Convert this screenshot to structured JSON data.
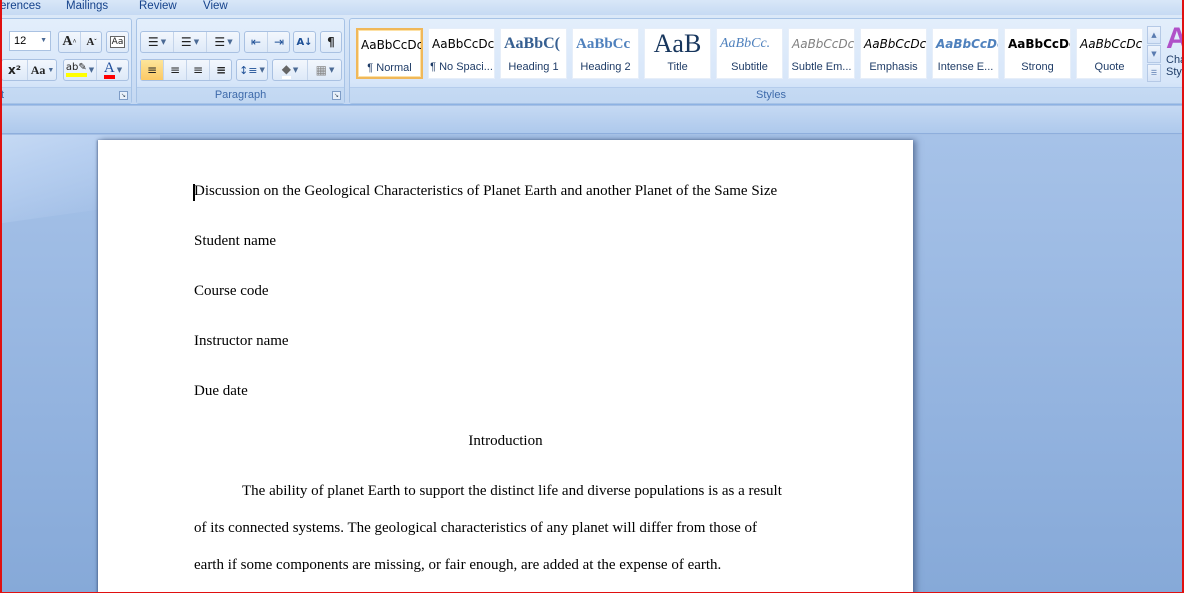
{
  "tabs": [
    "erences",
    "Mailings",
    "Review",
    "View"
  ],
  "font_group": {
    "label": "t",
    "font_size": "12",
    "buttons": {
      "grow_font": "A",
      "shrink_font": "A",
      "clear_formatting": "Aa",
      "superscript": "x²",
      "change_case": "Aa",
      "highlight": "ab",
      "font_color": "A"
    },
    "highlight_color": "#ffff00",
    "font_color": "#ff0000"
  },
  "paragraph_group": {
    "label": "Paragraph",
    "buttons": {
      "bullets": "☰",
      "numbering": "☰",
      "multilevel": "☰",
      "decrease_indent": "⇤",
      "increase_indent": "⇥",
      "sort": "A↓",
      "show_marks": "¶",
      "align_left": "≡",
      "center": "≡",
      "align_right": "≡",
      "justify": "≡",
      "line_spacing": "↕≡",
      "shading": "◆",
      "borders": "▦"
    },
    "active_alignment": "align_left"
  },
  "styles_group": {
    "label": "Styles",
    "items": [
      {
        "sample": "AaBbCcDc",
        "name": "¶ Normal",
        "selected": true
      },
      {
        "sample": "AaBbCcDc",
        "name": "¶ No Spaci..."
      },
      {
        "sample": "AaBbC(",
        "name": "Heading 1"
      },
      {
        "sample": "AaBbCc",
        "name": "Heading 2"
      },
      {
        "sample": "AaB",
        "name": "Title"
      },
      {
        "sample": "AaBbCc.",
        "name": "Subtitle"
      },
      {
        "sample": "AaBbCcDc",
        "name": "Subtle Em..."
      },
      {
        "sample": "AaBbCcDc",
        "name": "Emphasis"
      },
      {
        "sample": "AaBbCcDc",
        "name": "Intense E..."
      },
      {
        "sample": "AaBbCcDc",
        "name": "Strong"
      },
      {
        "sample": "AaBbCcDc",
        "name": "Quote"
      }
    ],
    "change_styles": {
      "icon": "A",
      "label1": "Cha",
      "label2": "Sty"
    }
  },
  "document": {
    "lines": [
      "Discussion on the Geological Characteristics of Planet Earth and another Planet of the Same Size",
      "Student name",
      "Course code",
      "Instructor name",
      "Due date"
    ],
    "heading": "Introduction",
    "paragraph_lines": [
      "The ability of planet Earth to support the distinct life and diverse populations is as a result",
      "of its connected systems. The geological characteristics of any planet will differ from those of",
      "earth if some components are missing, or fair enough, are added at the expense of earth."
    ]
  },
  "colors": {
    "selected_style_border": "#f0b85a",
    "active_button": "#fbc965",
    "window_border": "#e01010"
  }
}
